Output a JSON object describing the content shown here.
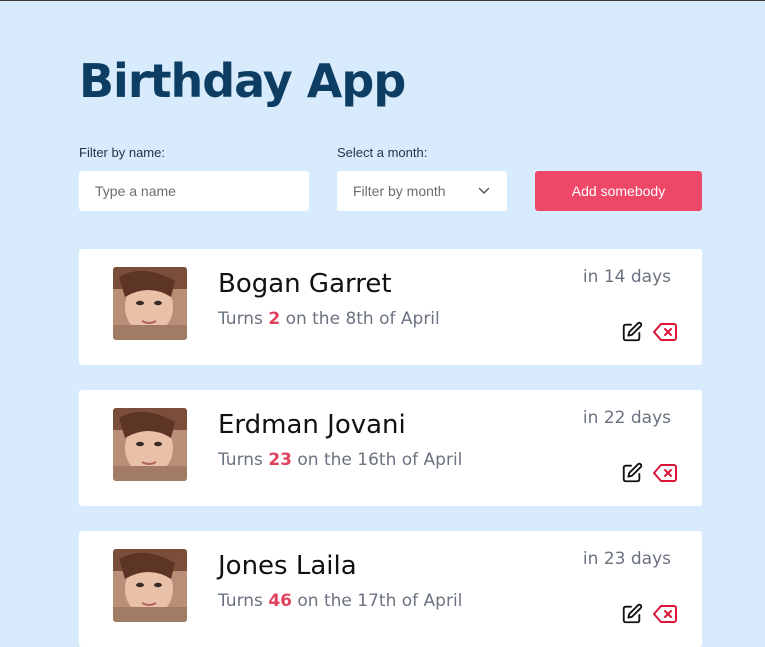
{
  "app": {
    "title": "Birthday App"
  },
  "filters": {
    "name_label": "Filter by name:",
    "name_placeholder": "Type a name",
    "name_value": "",
    "month_label": "Select a month:",
    "month_selected": "Filter by month"
  },
  "toolbar": {
    "add_label": "Add somebody"
  },
  "people": [
    {
      "name": "Bogan Garret",
      "turns_prefix": "Turns",
      "age": "2",
      "date_text": "on the 8th of April",
      "days_text": "in 14 days"
    },
    {
      "name": "Erdman Jovani",
      "turns_prefix": "Turns",
      "age": "23",
      "date_text": "on the 16th of April",
      "days_text": "in 22 days"
    },
    {
      "name": "Jones Laila",
      "turns_prefix": "Turns",
      "age": "46",
      "date_text": "on the 17th of April",
      "days_text": "in 23 days"
    }
  ],
  "icons": {
    "edit": "edit-icon",
    "delete": "backspace-delete-icon",
    "chevron": "chevron-down-icon"
  },
  "colors": {
    "background": "#d7ebfd",
    "title": "#0e3d63",
    "accent": "#ee4767",
    "age": "#e0425e",
    "delete_icon": "#d9163a"
  }
}
